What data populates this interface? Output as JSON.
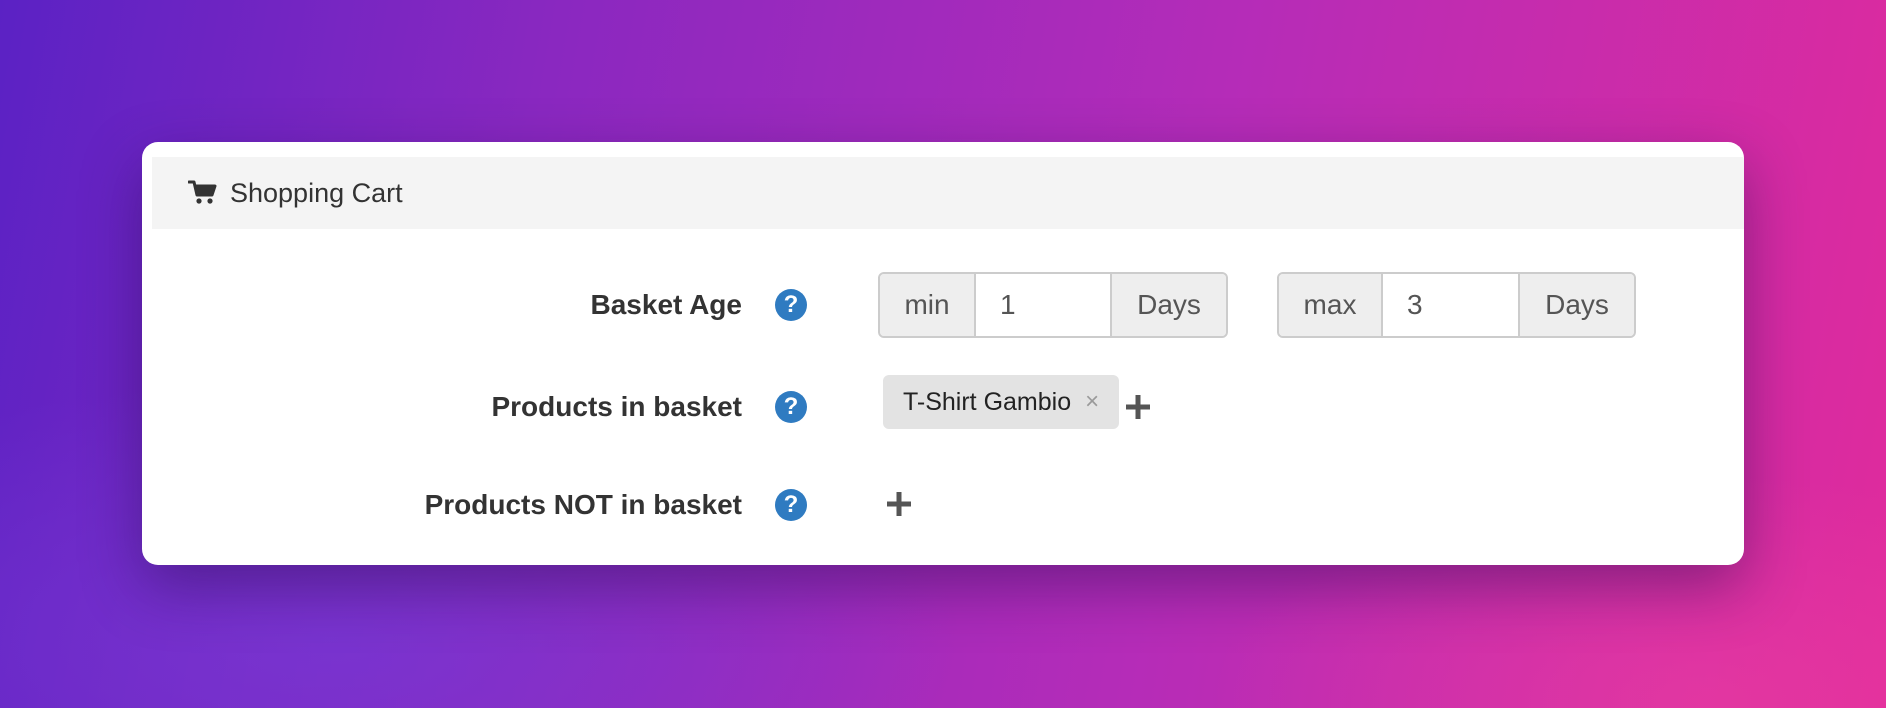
{
  "panel": {
    "title": "Shopping Cart",
    "icon": "shopping-cart-icon"
  },
  "basket_age": {
    "label": "Basket Age",
    "min_label": "min",
    "min_value": "1",
    "min_unit": "Days",
    "max_label": "max",
    "max_value": "3",
    "max_unit": "Days"
  },
  "products_in_basket": {
    "label": "Products in basket",
    "tags": [
      {
        "label": "T-Shirt Gambio",
        "remove": "×"
      }
    ],
    "add_icon": "plus-icon"
  },
  "products_not_in_basket": {
    "label": "Products NOT in basket",
    "tags": [],
    "add_icon": "plus-icon"
  },
  "help_icon_glyph": "?",
  "colors": {
    "help_icon": "#2f7bc1",
    "text": "#333333",
    "addon_bg": "#eeeeee",
    "tag_bg": "#e3e3e3"
  }
}
